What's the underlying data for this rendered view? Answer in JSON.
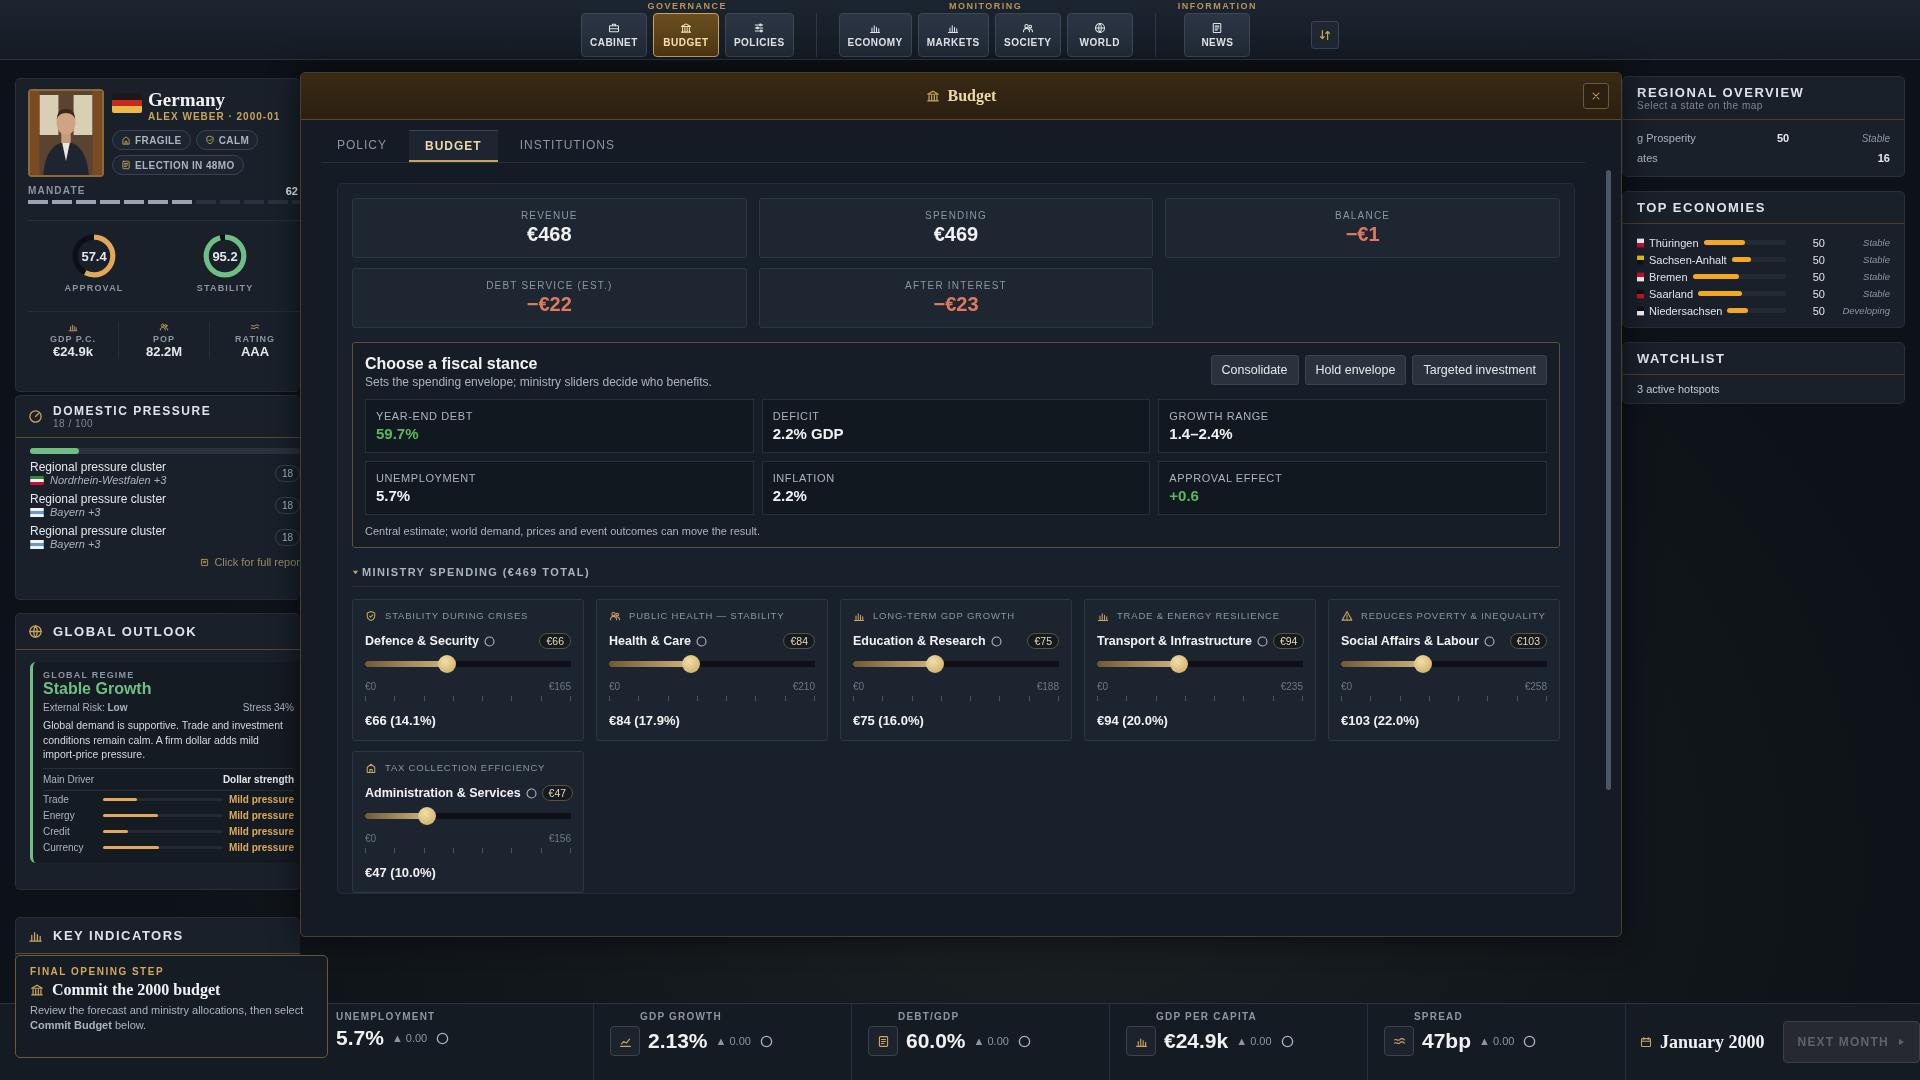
{
  "nav": {
    "groups": [
      {
        "label": "GOVERNANCE",
        "buttons": [
          {
            "label": "CABINET",
            "selected": false
          },
          {
            "label": "BUDGET",
            "selected": true
          },
          {
            "label": "POLICIES",
            "selected": false
          }
        ]
      },
      {
        "label": "MONITORING",
        "buttons": [
          {
            "label": "ECONOMY",
            "selected": false
          },
          {
            "label": "MARKETS",
            "selected": false
          },
          {
            "label": "SOCIETY",
            "selected": false
          },
          {
            "label": "WORLD",
            "selected": false
          }
        ]
      },
      {
        "label": "INFORMATION",
        "buttons": [
          {
            "label": "NEWS",
            "selected": false
          }
        ]
      }
    ]
  },
  "leader": {
    "country": "Germany",
    "subtitle": "ALEX WEBER · 2000-01",
    "chips": [
      "FRAGILE",
      "CALM",
      "ELECTION IN 48MO"
    ],
    "mandate": {
      "label": "MANDATE",
      "value": "62",
      "level": 0.62
    },
    "gauges": [
      {
        "label": "APPROVAL",
        "value": "57.4",
        "level": 0.574,
        "color": "#e0a957"
      },
      {
        "label": "STABILITY",
        "value": "95.2",
        "level": 0.952,
        "color": "#6fbf85"
      }
    ],
    "stats": [
      {
        "label": "GDP P.C.",
        "value": "€24.9k"
      },
      {
        "label": "POP",
        "value": "82.2M"
      },
      {
        "label": "RATING",
        "value": "AAA"
      }
    ]
  },
  "domestic_pressure": {
    "title": "DOMESTIC PRESSURE",
    "subtitle": "18 / 100",
    "level": 0.18,
    "items": [
      {
        "title": "Regional pressure cluster",
        "region": "Nordrhein-Westfalen +3",
        "score": "18"
      },
      {
        "title": "Regional pressure cluster",
        "region": "Bayern +3",
        "score": "18"
      },
      {
        "title": "Regional pressure cluster",
        "region": "Bayern +3",
        "score": "18"
      }
    ],
    "link": "Click for full repor"
  },
  "global_outlook": {
    "title": "GLOBAL OUTLOOK",
    "regime_label": "GLOBAL REGIME",
    "regime": "Stable Growth",
    "risk": "External Risk: **Low**",
    "stress": "Stress 34%",
    "summary": "Global demand is supportive. Trade and investment conditions remain calm. A firm dollar adds mild import-price pressure.",
    "driver_label": "Main Driver",
    "driver": "Dollar strength",
    "factors": [
      {
        "name": "Trade",
        "level": 0.28,
        "status": "Mild pressure"
      },
      {
        "name": "Energy",
        "level": 0.46,
        "status": "Mild pressure"
      },
      {
        "name": "Credit",
        "level": 0.21,
        "status": "Mild pressure"
      },
      {
        "name": "Currency",
        "level": 0.47,
        "status": "Mild pressure"
      }
    ]
  },
  "key_indicators": {
    "title": "KEY INDICATORS"
  },
  "onboarding": {
    "eyebrow": "FINAL OPENING STEP",
    "title": "Commit the 2000 budget",
    "text": "Review the forecast and ministry allocations, then select **Commit Budget** below."
  },
  "modal": {
    "title": "Budget",
    "tabs": [
      {
        "label": "POLICY",
        "selected": false
      },
      {
        "label": "BUDGET",
        "selected": true
      },
      {
        "label": "INSTITUTIONS",
        "selected": false
      }
    ],
    "summary": [
      {
        "label": "REVENUE",
        "value": "€468",
        "negative": false
      },
      {
        "label": "SPENDING",
        "value": "€469",
        "negative": false
      },
      {
        "label": "BALANCE",
        "value": "−€1",
        "negative": true
      },
      {
        "label": "DEBT SERVICE (EST.)",
        "value": "−€22",
        "negative": true
      },
      {
        "label": "AFTER INTEREST",
        "value": "−€23",
        "negative": true
      }
    ],
    "stance": {
      "title": "Choose a fiscal stance",
      "subtitle": "Sets the spending envelope; ministry sliders decide who benefits.",
      "options": [
        {
          "label": "Consolidate",
          "selected": false
        },
        {
          "label": "Hold envelope",
          "selected": false
        },
        {
          "label": "Targeted investment",
          "selected": false
        }
      ],
      "metrics": [
        {
          "label": "YEAR-END DEBT",
          "value": "59.7%",
          "positive": true
        },
        {
          "label": "DEFICIT",
          "value": "2.2% GDP",
          "positive": false
        },
        {
          "label": "GROWTH RANGE",
          "value": "1.4–2.4%",
          "positive": false
        },
        {
          "label": "UNEMPLOYMENT",
          "value": "5.7%",
          "positive": false
        },
        {
          "label": "INFLATION",
          "value": "2.2%",
          "positive": false
        },
        {
          "label": "APPROVAL EFFECT",
          "value": "+0.6",
          "positive": true
        }
      ],
      "note": "Central estimate; world demand, prices and event outcomes can move the result."
    },
    "ministry": {
      "title": "MINISTRY SPENDING (€469 TOTAL)",
      "expanded": true,
      "cards": [
        {
          "tag": "STABILITY DURING CRISES",
          "name": "Defence & Security",
          "chip": "€66",
          "min": "€0",
          "max": "€165",
          "level": 0.4,
          "value": "€66 (14.1%)"
        },
        {
          "tag": "PUBLIC HEALTH — STABILITY",
          "name": "Health & Care",
          "chip": "€84",
          "min": "€0",
          "max": "€210",
          "level": 0.4,
          "value": "€84 (17.9%)"
        },
        {
          "tag": "LONG-TERM GDP GROWTH",
          "name": "Education & Research",
          "chip": "€75",
          "min": "€0",
          "max": "€188",
          "level": 0.4,
          "value": "€75 (16.0%)"
        },
        {
          "tag": "TRADE & ENERGY RESILIENCE",
          "name": "Transport & Infrastructure",
          "chip": "€94",
          "min": "€0",
          "max": "€235",
          "level": 0.4,
          "value": "€94 (20.0%)"
        },
        {
          "tag": "REDUCES POVERTY & INEQUALITY",
          "name": "Social Affairs & Labour",
          "chip": "€103",
          "min": "€0",
          "max": "€258",
          "level": 0.4,
          "value": "€103 (22.0%)"
        },
        {
          "tag": "TAX COLLECTION EFFICIENCY",
          "name": "Administration & Services",
          "chip": "€47",
          "min": "€0",
          "max": "€156",
          "level": 0.3,
          "value": "€47 (10.0%)"
        }
      ]
    }
  },
  "right": {
    "regional": {
      "title": "REGIONAL OVERVIEW",
      "subtitle": "Select a state on the map",
      "rows": [
        {
          "label": "g Prosperity",
          "value": "50",
          "status": "Stable"
        },
        {
          "label": "ates",
          "value": "16"
        }
      ]
    },
    "economies": {
      "title": "TOP ECONOMIES",
      "rows": [
        {
          "name": "Thüringen",
          "level": 0.5,
          "value": "50",
          "status": "Stable"
        },
        {
          "name": "Sachsen-Anhalt",
          "level": 0.36,
          "value": "50",
          "status": "Stable"
        },
        {
          "name": "Bremen",
          "level": 0.5,
          "value": "50",
          "status": "Stable"
        },
        {
          "name": "Saarland",
          "level": 0.5,
          "value": "50",
          "status": "Stable"
        },
        {
          "name": "Niedersachsen",
          "level": 0.35,
          "value": "50",
          "status": "Developing"
        }
      ]
    },
    "watchlist": {
      "title": "WATCHLIST",
      "text": "3 active hotspots"
    }
  },
  "status_bar": {
    "metrics": [
      {
        "label": "UNEMPLOYMENT",
        "value": "5.7%",
        "delta": "▲ 0.00"
      },
      {
        "label": "GDP GROWTH",
        "value": "2.13%",
        "delta": "▲ 0.00"
      },
      {
        "label": "DEBT/GDP",
        "value": "60.0%",
        "delta": "▲ 0.00"
      },
      {
        "label": "GDP PER CAPITA",
        "value": "€24.9k",
        "delta": "▲ 0.00"
      },
      {
        "label": "SPREAD",
        "value": "47bp",
        "delta": "▲ 0.00"
      }
    ],
    "date": "January 2000",
    "next": {
      "label": "NEXT MONTH",
      "disabled": true
    }
  }
}
